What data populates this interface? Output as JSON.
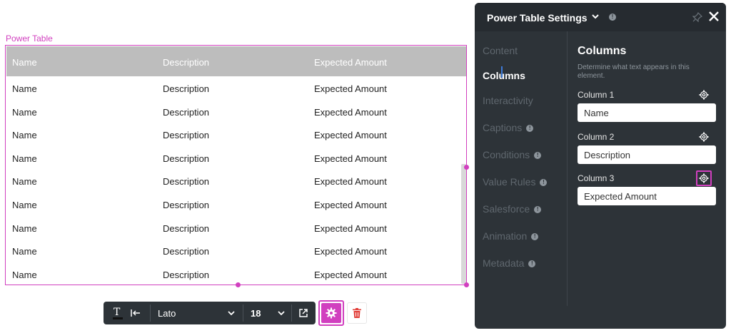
{
  "table": {
    "caption": "Power Table",
    "headers": [
      "Name",
      "Description",
      "Expected Amount"
    ],
    "rows": [
      [
        "Name",
        "Description",
        "Expected Amount"
      ],
      [
        "Name",
        "Description",
        "Expected Amount"
      ],
      [
        "Name",
        "Description",
        "Expected Amount"
      ],
      [
        "Name",
        "Description",
        "Expected Amount"
      ],
      [
        "Name",
        "Description",
        "Expected Amount"
      ],
      [
        "Name",
        "Description",
        "Expected Amount"
      ],
      [
        "Name",
        "Description",
        "Expected Amount"
      ],
      [
        "Name",
        "Description",
        "Expected Amount"
      ],
      [
        "Name",
        "Description",
        "Expected Amount"
      ]
    ]
  },
  "toolbar": {
    "font_name": "Lato",
    "font_size": "18",
    "icons": [
      "text-color-icon",
      "indent-icon",
      "chevron-down-icon",
      "external-link-icon",
      "gear-icon",
      "trash-icon"
    ]
  },
  "panel": {
    "title": "Power Table Settings",
    "nav": [
      {
        "label": "Content",
        "info": false
      },
      {
        "label": "Columns",
        "info": false
      },
      {
        "label": "Interactivity",
        "info": false
      },
      {
        "label": "Captions",
        "info": true
      },
      {
        "label": "Conditions",
        "info": true
      },
      {
        "label": "Value Rules",
        "info": true
      },
      {
        "label": "Salesforce",
        "info": true
      },
      {
        "label": "Animation",
        "info": true
      },
      {
        "label": "Metadata",
        "info": true
      }
    ],
    "active_nav": "Columns",
    "section_title": "Columns",
    "section_desc": "Determine what text appears in this element.",
    "columns": [
      {
        "label": "Column 1",
        "value": "Name"
      },
      {
        "label": "Column 2",
        "value": "Description"
      },
      {
        "label": "Column 3",
        "value": "Expected Amount"
      }
    ]
  },
  "colors": {
    "accent": "#d13fbf",
    "panel_bg": "#2d3338",
    "header_bg": "#bdbdbd"
  }
}
